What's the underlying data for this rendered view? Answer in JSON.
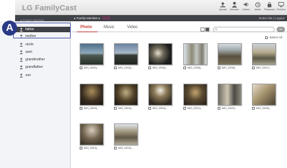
{
  "app": {
    "title": "LG FamilyCast"
  },
  "toolbar": {
    "items": [
      {
        "label": "Upload",
        "icon": "upload-icon"
      },
      {
        "label": "Member",
        "icon": "member-icon"
      },
      {
        "label": "Notice",
        "icon": "notice-icon"
      },
      {
        "label": "Alarm",
        "icon": "alarm-icon"
      },
      {
        "label": "Password",
        "icon": "lock-icon"
      },
      {
        "label": "Preview",
        "icon": "preview-icon"
      }
    ]
  },
  "subbar": {
    "breadcrumb": "▸ Family Member ▸",
    "right_text": "Notice list | Logout"
  },
  "sidebar": {
    "header": "▸ Family Member",
    "items": [
      {
        "label": "father"
      },
      {
        "label": "mother"
      },
      {
        "label": "uncle"
      },
      {
        "label": "aunt"
      },
      {
        "label": "grandmother"
      },
      {
        "label": "grandfather"
      },
      {
        "label": "son"
      }
    ]
  },
  "callout": {
    "label": "A"
  },
  "tabs": [
    {
      "label": "Photo"
    },
    {
      "label": "Music"
    },
    {
      "label": "Video"
    }
  ],
  "search": {
    "placeholder": "",
    "button": "OK"
  },
  "select_all": "Select All",
  "photos": [
    {
      "caption": "IMG_0540(..."
    },
    {
      "caption": "IMG_0544(..."
    },
    {
      "caption": "IMG_0535(..."
    },
    {
      "caption": "IMG_0538(..."
    },
    {
      "caption": "IMG_0536(..."
    },
    {
      "caption": "IMG_0547(..."
    },
    {
      "caption": "IMG_0509(..."
    },
    {
      "caption": "IMG_0503(..."
    },
    {
      "caption": "IMG_0504(..."
    },
    {
      "caption": "IMG_0521(..."
    },
    {
      "caption": "IMG_0522(..."
    },
    {
      "caption": "IMG_0526(..."
    },
    {
      "caption": "IMG_0515(..."
    },
    {
      "caption": "IMG_0510(..."
    }
  ]
}
